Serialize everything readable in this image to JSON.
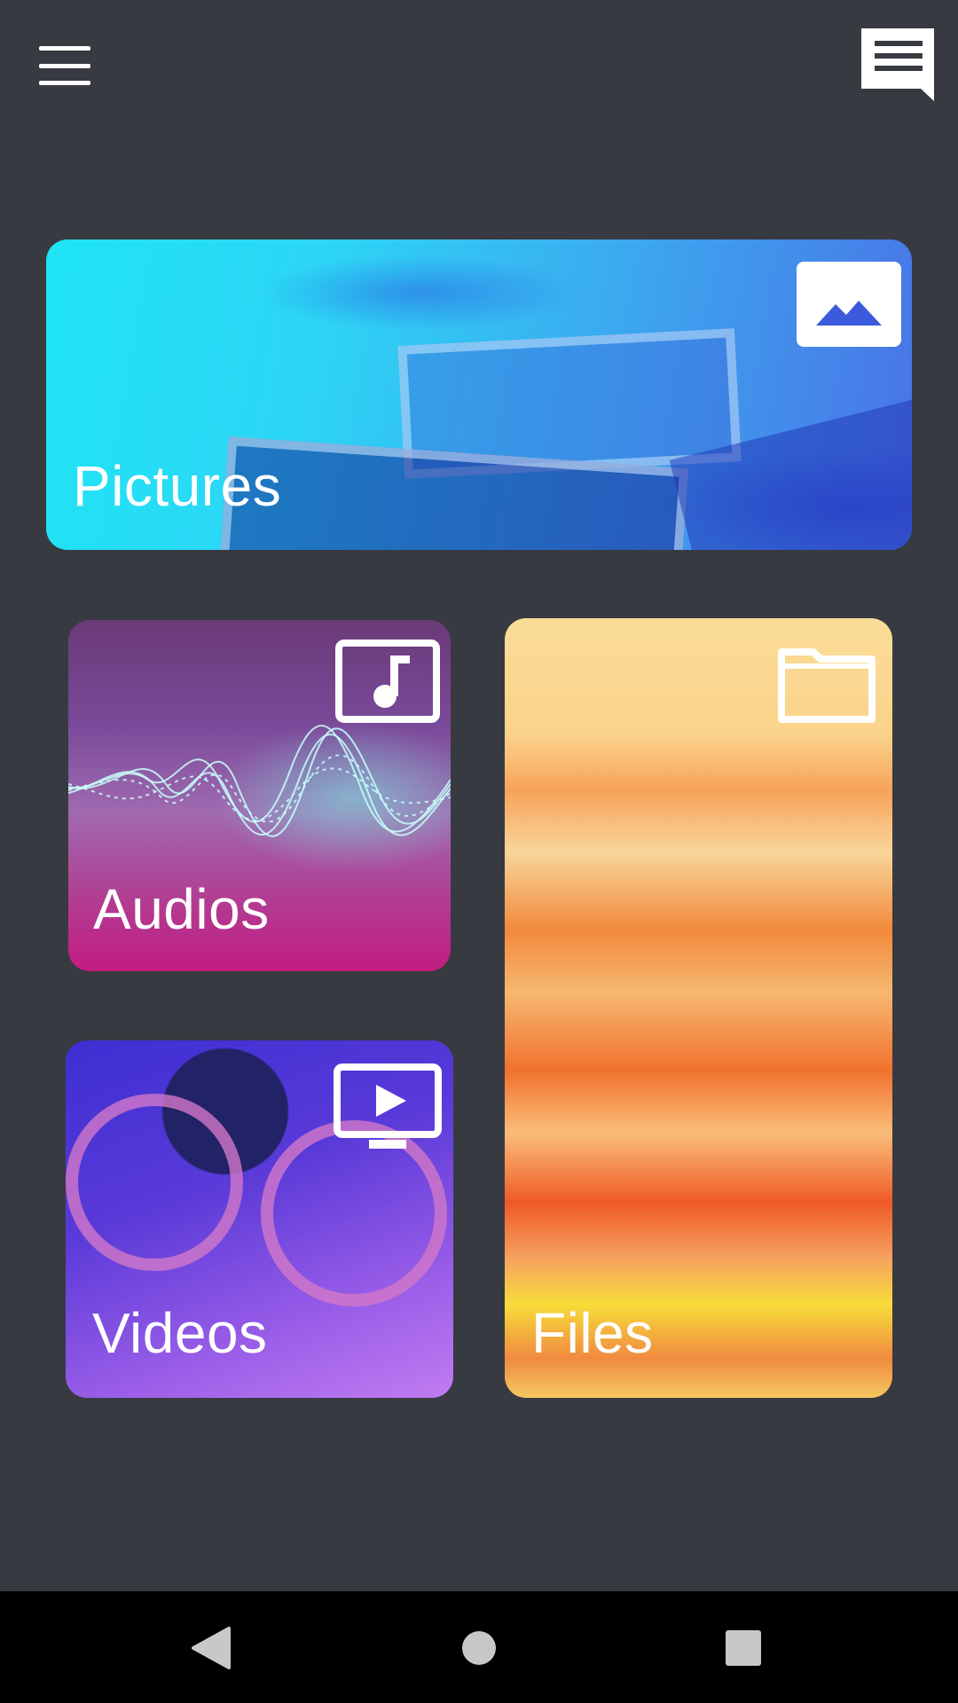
{
  "toolbar": {
    "menu_icon": "hamburger-menu-icon",
    "feedback_icon": "chat-feedback-icon"
  },
  "tiles": {
    "pictures": {
      "label": "Pictures",
      "icon": "image-icon",
      "accent": "#1fe4f5"
    },
    "audios": {
      "label": "Audios",
      "icon": "music-note-icon",
      "accent": "#c21c80"
    },
    "videos": {
      "label": "Videos",
      "icon": "video-play-icon",
      "accent": "#3d2fd2"
    },
    "files": {
      "label": "Files",
      "icon": "folder-icon",
      "accent": "#f28a3c"
    }
  },
  "navbar": {
    "back_icon": "back-triangle-icon",
    "home_icon": "home-circle-icon",
    "recents_icon": "recents-square-icon"
  }
}
